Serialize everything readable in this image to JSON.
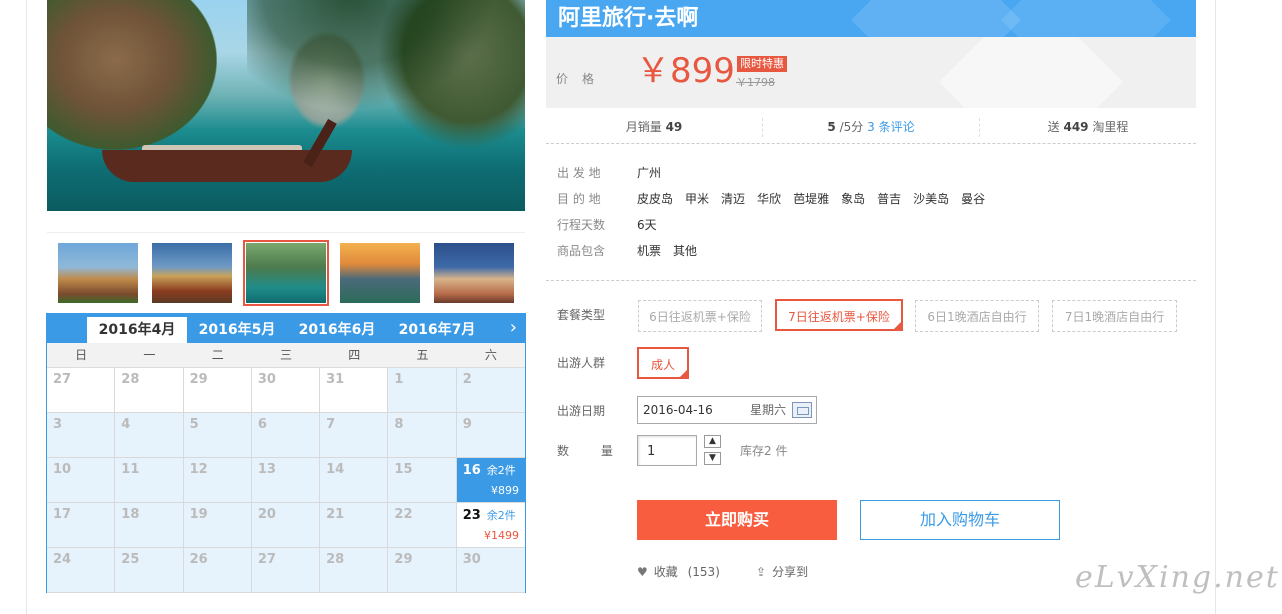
{
  "gallery": {
    "thumbnails": [
      "thumb-temple-1",
      "thumb-temple-2",
      "thumb-lagoon",
      "thumb-sunset-island",
      "thumb-palace"
    ],
    "selected_index": 2
  },
  "calendar": {
    "months": [
      "2016年4月",
      "2016年5月",
      "2016年6月",
      "2016年7月"
    ],
    "active_month": "2016年4月",
    "next_icon": "chevron-right-icon",
    "weekdays": [
      "日",
      "一",
      "二",
      "三",
      "四",
      "五",
      "六"
    ],
    "weeks": [
      [
        {
          "d": "27"
        },
        {
          "d": "28"
        },
        {
          "d": "29"
        },
        {
          "d": "30"
        },
        {
          "d": "31"
        },
        {
          "d": "1"
        },
        {
          "d": "2"
        }
      ],
      [
        {
          "d": "3"
        },
        {
          "d": "4"
        },
        {
          "d": "5"
        },
        {
          "d": "6"
        },
        {
          "d": "7"
        },
        {
          "d": "8"
        },
        {
          "d": "9"
        }
      ],
      [
        {
          "d": "10"
        },
        {
          "d": "11"
        },
        {
          "d": "12"
        },
        {
          "d": "13"
        },
        {
          "d": "14"
        },
        {
          "d": "15"
        },
        {
          "d": "16",
          "stock": "余2件",
          "price": "¥899"
        }
      ],
      [
        {
          "d": "17"
        },
        {
          "d": "18"
        },
        {
          "d": "19"
        },
        {
          "d": "20"
        },
        {
          "d": "21"
        },
        {
          "d": "22"
        },
        {
          "d": "23",
          "stock": "余2件",
          "price": "¥1499"
        }
      ],
      [
        {
          "d": "24"
        },
        {
          "d": "25"
        },
        {
          "d": "26"
        },
        {
          "d": "27"
        },
        {
          "d": "28"
        },
        {
          "d": "29"
        },
        {
          "d": "30"
        }
      ]
    ]
  },
  "header": {
    "brand": "阿里旅行·去啊"
  },
  "price": {
    "label": "价格",
    "current": "￥899",
    "badge": "限时特惠",
    "original": "￥1798"
  },
  "stats": {
    "sales_label": "月销量",
    "sales": "49",
    "rating": "5",
    "rating_suffix": "/5分",
    "reviews_link": "3 条评论",
    "points_prefix": "送",
    "points": "449",
    "points_suffix": "淘里程"
  },
  "details": {
    "departure_label": "出 发 地",
    "departure": "广州",
    "destination_label": "目 的 地",
    "destinations": [
      "皮皮岛",
      "甲米",
      "清迈",
      "华欣",
      "芭堤雅",
      "象岛",
      "普吉",
      "沙美岛",
      "曼谷"
    ],
    "days_label": "行程天数",
    "days": "6天",
    "includes_label": "商品包含",
    "includes": [
      "机票",
      "其他"
    ]
  },
  "package": {
    "label": "套餐类型",
    "options": [
      "6日往返机票+保险",
      "7日往返机票+保险",
      "6日1晚酒店自由行",
      "7日1晚酒店自由行"
    ],
    "selected": "7日往返机票+保险"
  },
  "travelers": {
    "label": "出游人群",
    "options": [
      "成人"
    ],
    "selected": "成人"
  },
  "date": {
    "label": "出游日期",
    "value": "2016-04-16",
    "weekday": "星期六"
  },
  "quantity": {
    "label": "数 量",
    "value": "1",
    "stock": "库存2 件"
  },
  "actions": {
    "buy": "立即购买",
    "cart": "加入购物车",
    "favorite": "收藏",
    "favorite_count": "(153)",
    "share": "分享到"
  },
  "watermark": "eLvXing.net",
  "colors": {
    "accent": "#3a9ae6",
    "price": "#e8573f",
    "buy": "#f95d3f"
  }
}
